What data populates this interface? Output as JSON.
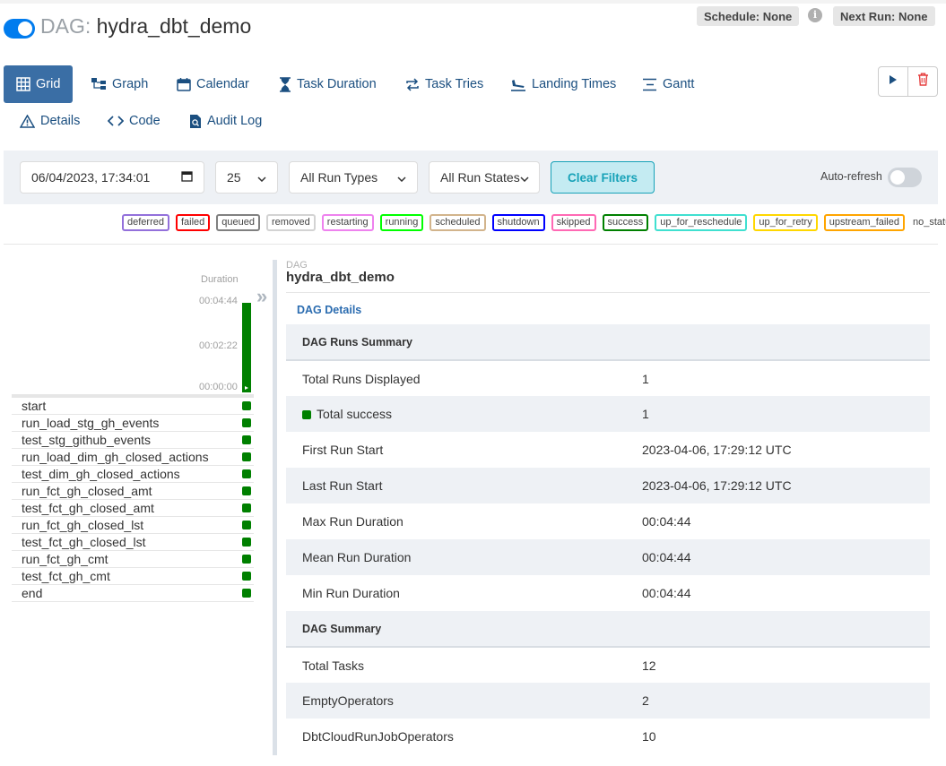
{
  "header": {
    "dag_prefix": "DAG:",
    "dag_name": "hydra_dbt_demo",
    "schedule_badge": "Schedule: None",
    "next_run_badge": "Next Run: None",
    "paused": false
  },
  "nav": {
    "tabs": [
      {
        "label": "Grid",
        "icon": "grid-icon",
        "active": true
      },
      {
        "label": "Graph",
        "icon": "graph-icon"
      },
      {
        "label": "Calendar",
        "icon": "calendar-icon"
      },
      {
        "label": "Task Duration",
        "icon": "hourglass-icon"
      },
      {
        "label": "Task Tries",
        "icon": "retry-icon"
      },
      {
        "label": "Landing Times",
        "icon": "landing-icon"
      },
      {
        "label": "Gantt",
        "icon": "gantt-icon"
      },
      {
        "label": "Details",
        "icon": "warning-triangle-icon"
      },
      {
        "label": "Code",
        "icon": "code-icon"
      },
      {
        "label": "Audit Log",
        "icon": "document-search-icon"
      }
    ],
    "actions": [
      {
        "name": "trigger-dag",
        "icon": "play-icon"
      },
      {
        "name": "delete-dag",
        "icon": "trash-icon"
      }
    ]
  },
  "filters": {
    "date_value": "06/04/2023, 17:34:01",
    "num_runs": "25",
    "run_type": "All Run Types",
    "run_state": "All Run States",
    "clear_label": "Clear Filters",
    "auto_refresh_label": "Auto-refresh",
    "auto_refresh_on": false
  },
  "legend": [
    {
      "label": "deferred",
      "color": "#9370db"
    },
    {
      "label": "failed",
      "color": "#ff0000"
    },
    {
      "label": "queued",
      "color": "#808080"
    },
    {
      "label": "removed",
      "color": "#d3d3d3"
    },
    {
      "label": "restarting",
      "color": "#ee82ee"
    },
    {
      "label": "running",
      "color": "#00ff00"
    },
    {
      "label": "scheduled",
      "color": "#d2b48c"
    },
    {
      "label": "shutdown",
      "color": "#0000ff"
    },
    {
      "label": "skipped",
      "color": "#ff69b4"
    },
    {
      "label": "success",
      "color": "#008000"
    },
    {
      "label": "up_for_reschedule",
      "color": "#40e0d0"
    },
    {
      "label": "up_for_retry",
      "color": "#ffd700"
    },
    {
      "label": "upstream_failed",
      "color": "#ffa500"
    },
    {
      "label": "no_status",
      "color": null
    }
  ],
  "grid": {
    "duration_label": "Duration",
    "ticks": [
      "00:04:44",
      "00:02:22",
      "00:00:00"
    ],
    "run_duration_fraction": 1.0,
    "tasks": [
      "start",
      "run_load_stg_gh_events",
      "test_stg_github_events",
      "run_load_dim_gh_closed_actions",
      "test_dim_gh_closed_actions",
      "run_fct_gh_closed_amt",
      "test_fct_gh_closed_amt",
      "run_fct_gh_closed_lst",
      "test_fct_gh_closed_lst",
      "run_fct_gh_cmt",
      "test_fct_gh_cmt",
      "end"
    ],
    "task_state_color": "#008000"
  },
  "details": {
    "kicker": "DAG",
    "name": "hydra_dbt_demo",
    "tab": "DAG Details",
    "sections": [
      {
        "title": "DAG Runs Summary",
        "rows": [
          {
            "label": "Total Runs Displayed",
            "value": "1"
          },
          {
            "label": "Total success",
            "value": "1",
            "marker": true
          },
          {
            "label": "First Run Start",
            "value": "2023-04-06, 17:29:12 UTC"
          },
          {
            "label": "Last Run Start",
            "value": "2023-04-06, 17:29:12 UTC"
          },
          {
            "label": "Max Run Duration",
            "value": "00:04:44"
          },
          {
            "label": "Mean Run Duration",
            "value": "00:04:44"
          },
          {
            "label": "Min Run Duration",
            "value": "00:04:44"
          }
        ]
      },
      {
        "title": "DAG Summary",
        "rows": [
          {
            "label": "Total Tasks",
            "value": "12"
          },
          {
            "label": "EmptyOperators",
            "value": "2"
          },
          {
            "label": "DbtCloudRunJobOperators",
            "value": "10"
          }
        ]
      }
    ]
  }
}
